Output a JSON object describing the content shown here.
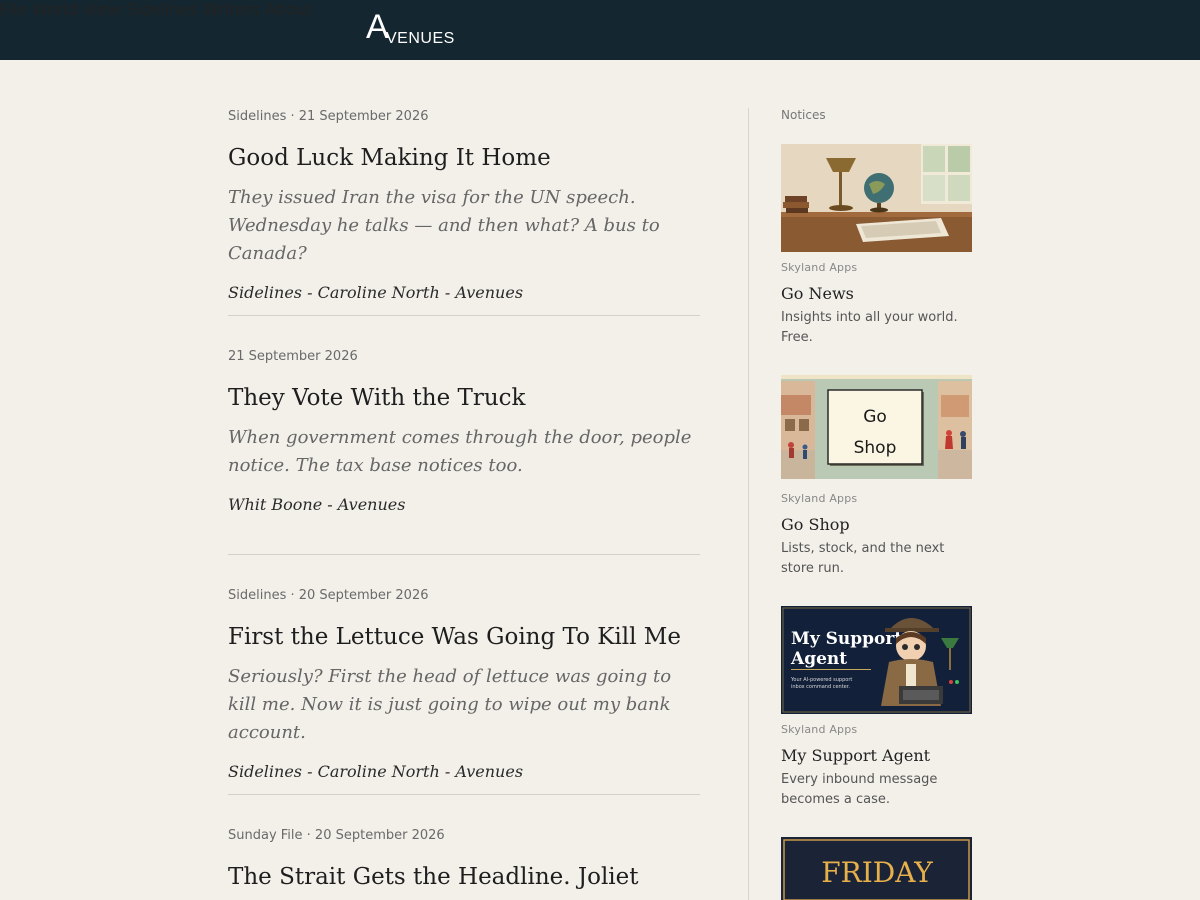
{
  "header": {
    "logo_big": "A",
    "logo_rest": "VENUES",
    "nav": [
      "File",
      "World View",
      "Sidelines",
      "Writers",
      "About"
    ]
  },
  "articles": [
    {
      "meta": "Sidelines · 21 September 2026",
      "title": "Good Luck Making It Home",
      "dek": "They issued Iran the visa for the UN speech. Wednesday he talks — and then what? A bus to Canada?",
      "byline": "Sidelines - Caroline North - Avenues"
    },
    {
      "meta": "21 September 2026",
      "title": "They Vote With the Truck",
      "dek": "When government comes through the door, people notice. The tax base notices too.",
      "byline": "Whit Boone - Avenues"
    },
    {
      "meta": "Sidelines · 20 September 2026",
      "title": "First the Lettuce Was Going To Kill Me",
      "dek": "Seriously? First the head of lettuce was going to kill me. Now it is just going to wipe out my bank account.",
      "byline": "Sidelines - Caroline North - Avenues"
    },
    {
      "meta": "Sunday File · 20 September 2026",
      "title": "The Strait Gets the Headline. Joliet",
      "dek": "",
      "byline": ""
    }
  ],
  "sidebar": {
    "label": "Notices",
    "ads": [
      {
        "source": "Skyland Apps",
        "name": "Go News",
        "desc": "Insights into all your world. Free.",
        "icon": "desk-globe-image"
      },
      {
        "source": "Skyland Apps",
        "name": "Go Shop",
        "desc": "Lists, stock, and the next store run.",
        "icon": "go-shop-image",
        "sign_line1": "Go",
        "sign_line2": "Shop"
      },
      {
        "source": "Skyland Apps",
        "name": "My Support Agent",
        "desc": "Every inbound message becomes a case.",
        "icon": "support-agent-image",
        "img_title1": "My Support",
        "img_title2": "Agent",
        "img_sub1": "Your AI-powered support",
        "img_sub2": "inbox command center."
      },
      {
        "icon": "friday-image",
        "img_text": "FRIDAY"
      }
    ]
  },
  "colors": {
    "header_bg": "#14262f",
    "page_bg": "#f3f0ea",
    "nav_text": "#c9dbe2"
  }
}
